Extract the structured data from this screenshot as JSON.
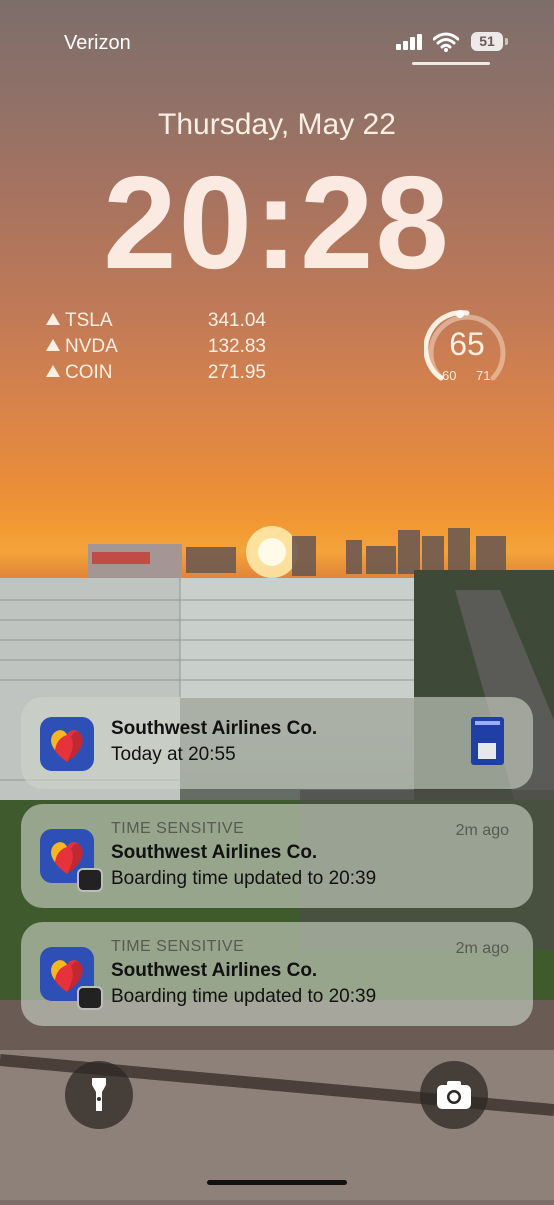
{
  "status_bar": {
    "carrier": "Verizon",
    "battery_level": "51",
    "signal_icon": "cellular-signal-icon",
    "wifi_icon": "wifi-icon"
  },
  "lock_screen": {
    "date": "Thursday, May 22",
    "time": "20:28"
  },
  "stocks_widget": {
    "items": [
      {
        "symbol": "TSLA",
        "value": "341.04"
      },
      {
        "symbol": "NVDA",
        "value": "132.83"
      },
      {
        "symbol": "COIN",
        "value": "271.95"
      }
    ]
  },
  "weather_widget": {
    "current": "65",
    "low": "60",
    "high": "71"
  },
  "notifications": [
    {
      "app": "Southwest Airlines Co.",
      "body": "Today at 20:55",
      "icon": "southwest-heart-icon"
    },
    {
      "label": "TIME SENSITIVE",
      "time": "2m ago",
      "app": "Southwest Airlines Co.",
      "body": "Boarding time updated to 20:39",
      "icon": "southwest-heart-icon"
    },
    {
      "label": "TIME SENSITIVE",
      "time": "2m ago",
      "app": "Southwest Airlines Co.",
      "body": "Boarding time updated to 20:39",
      "icon": "southwest-heart-icon"
    }
  ],
  "quick_actions": {
    "left_icon": "flashlight-icon",
    "right_icon": "camera-icon"
  },
  "colors": {
    "notification_bg": "#cdd4c8",
    "brand_blue": "#2e4fb5",
    "heart_red": "#e5323b",
    "heart_yellow": "#f5b81e"
  }
}
